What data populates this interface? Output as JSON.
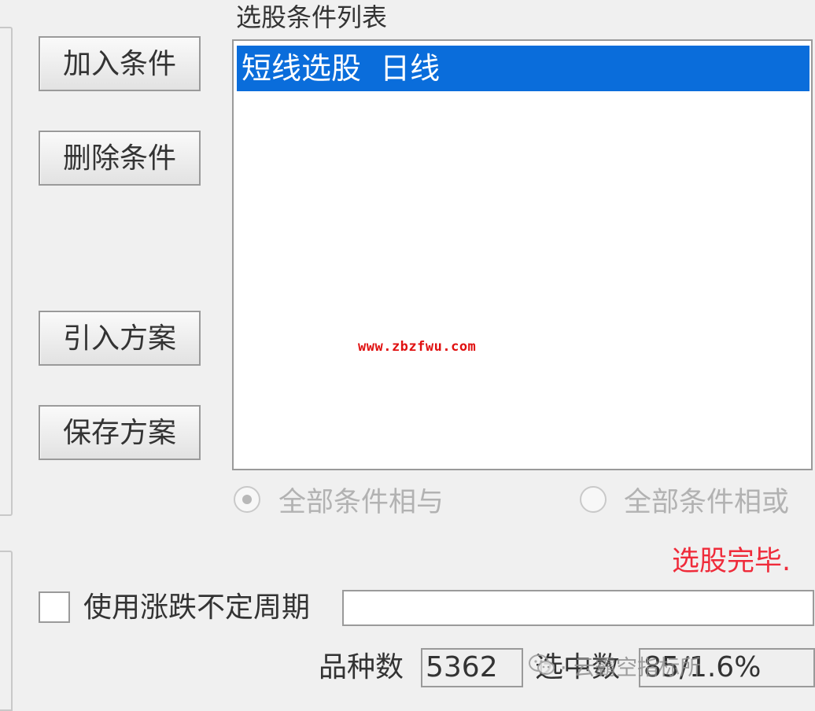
{
  "buttons": {
    "add": "加入条件",
    "delete": "删除条件",
    "import": "引入方案",
    "save": "保存方案"
  },
  "condition_list": {
    "caption": "选股条件列表",
    "items": [
      {
        "label": "短线选股  日线",
        "selected": true
      }
    ]
  },
  "watermark_url": "www.zbzfwu.com",
  "logic": {
    "and_label": "全部条件相与",
    "or_label": "全部条件相或",
    "selected": "and"
  },
  "status": {
    "text": "选股完毕.",
    "color": "#ef2b3a"
  },
  "period": {
    "checkbox_label": "使用涨跌不定周期",
    "checked": false,
    "value": ""
  },
  "stats": {
    "count_label": "品种数",
    "count_value": "5362",
    "selected_label": "选中数",
    "selected_value": "85/1.6%"
  },
  "overlay_badge": {
    "icon": "wechat-icon",
    "text": "· 云霸空指标所"
  },
  "colors": {
    "selection": "#0a6ddb",
    "background": "#f0f0f0"
  }
}
